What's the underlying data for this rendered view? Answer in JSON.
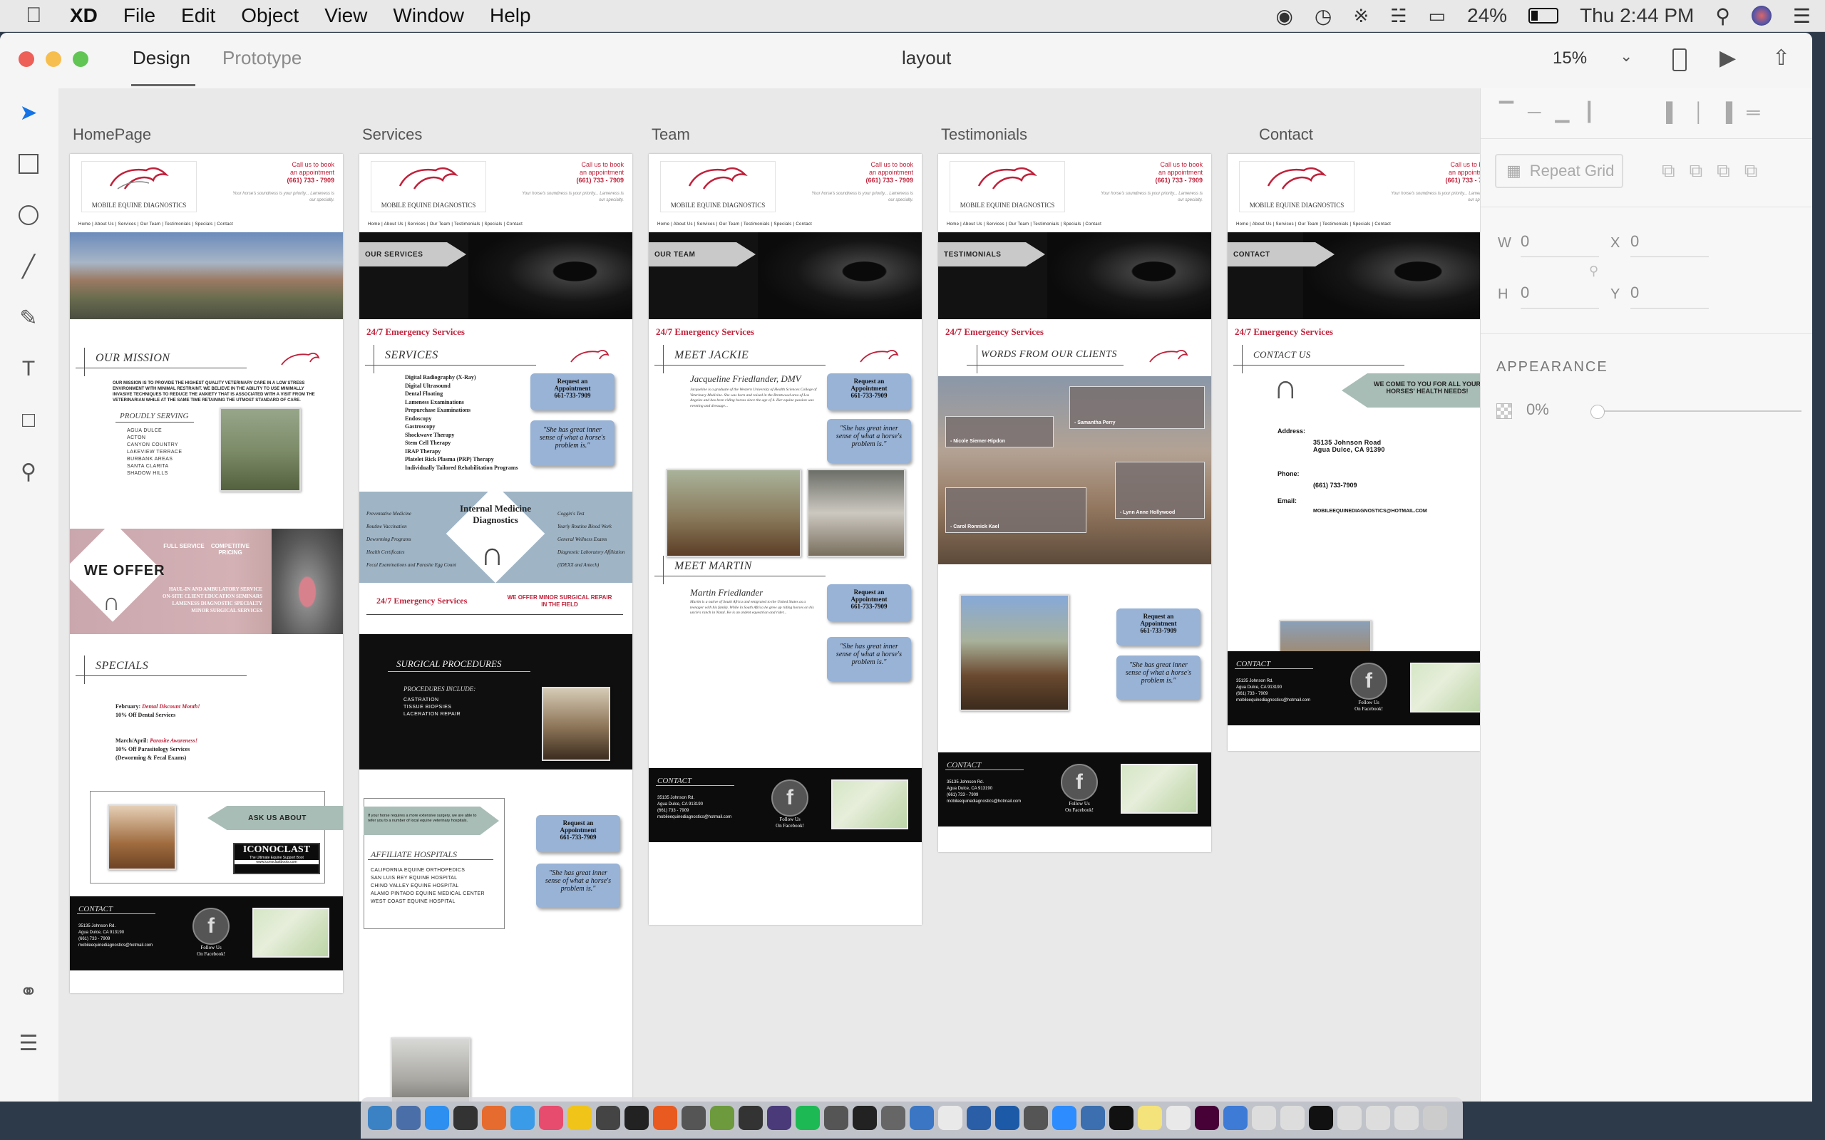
{
  "menubar": {
    "app": "XD",
    "items": [
      "File",
      "Edit",
      "Object",
      "View",
      "Window",
      "Help"
    ],
    "battery": "24%",
    "clock": "Thu 2:44 PM"
  },
  "window": {
    "tabs": {
      "design": "Design",
      "prototype": "Prototype"
    },
    "doc_title": "layout",
    "zoom": "15%"
  },
  "artboards": {
    "home": "HomePage",
    "services": "Services",
    "team": "Team",
    "testimonials": "Testimonials",
    "contact": "Contact"
  },
  "site": {
    "logo_text": "MOBILE EQUINE DIAGNOSTICS",
    "call_text_1": "Call us to book",
    "call_text_2": "an appointment",
    "call_phone": "(661) 733 - 7909",
    "call_sub": "Your horse's soundness is your priority... Lameness is our specialty.",
    "nav": "Home | About Us | Services | Our Team | Testimonials | Specials | Contact",
    "emergency": "24/7 Emergency Services",
    "request_1": "Request an",
    "request_2": "Appointment",
    "request_phone": "661-733-7909",
    "quote": "\"She has great inner sense of what a horse's problem is.\"",
    "contact_title": "CONTACT",
    "contact_info_1": "35135 Johnson Rd.",
    "contact_info_2": "Agua Dulce, CA 913190",
    "contact_info_3": "(661) 733 - 7909",
    "contact_info_4": "mobileequinediagnostics@hotmail.com",
    "follow_1": "Follow Us",
    "follow_2": "On Facebook!",
    "fb_glyph": "f"
  },
  "home": {
    "mission_title": "OUR MISSION",
    "mission_body": "Our mission is to provide the highest quality veterinary care in a low stress environment with minimal restraint. We believe in the ability to use minimally invasive techniques to reduce the anxiety that is associated with a visit from the veterinarian while at the same time retaining the utmost standard of care.",
    "proudly_serving": "PROUDLY SERVING",
    "areas": [
      "Agua Dulce",
      "Acton",
      "Canyon Country",
      "Lakeview Terrace",
      "Burbank Areas",
      "Santa Clarita",
      "Shadow Hills"
    ],
    "we_offer": "WE OFFER",
    "full_service": "FULL SERVICE",
    "competitive_pricing": "COMPETITIVE PRICING",
    "offer_lines": [
      "HAUL-IN AND AMBULATORY SERVICE",
      "ON-SITE CLIENT EDUCATION SEMINARS",
      "LAMENESS DIAGNOSTIC SPECIALTY",
      "MINOR SURGICAL SERVICES"
    ],
    "specials_title": "SPECIALS",
    "feb_label": "February:",
    "feb_italic": "Dental Discount Month!",
    "feb_detail": "10% Off Dental Services",
    "mar_label": "March/April:",
    "mar_italic": "Parasite Awareness!",
    "mar_detail_1": "10% Off Parasitology Services",
    "mar_detail_2": "(Deworming & Fecal Exams)",
    "ask_us": "ASK US ABOUT",
    "iconoclast": "ICONOCLAST",
    "iconoclast_sub": "The Ultimate Equine Support Boot",
    "iconoclast_url": "www.iconoclastboots.com"
  },
  "services": {
    "banner": "OUR SERVICES",
    "section_title": "SERVICES",
    "list": [
      "Digital Radiography (X-Ray)",
      "Digital Ultrasound",
      "Dental Floating",
      "Lameness Examinations",
      "Prepurchase Examinations",
      "Endoscopy",
      "Gastroscopy",
      "Shockwave Therapy",
      "Stem Cell Therapy",
      "IRAP Therapy",
      "Platelet Rick Plasma (PRP) Therapy",
      "Individually Tailored Rehabilitation Programs"
    ],
    "internal_medicine": "Internal Medicine Diagnostics",
    "im_left": [
      "Preventative Medicine",
      "Routine Vaccination",
      "Deworming Programs",
      "Health Certificates",
      "Fecal Examinations and Parasite Egg Count"
    ],
    "im_right": [
      "Coggin's Test",
      "Yearly Routine Blood Work",
      "General Wellness Exams",
      "Diagnostic Laboratory Affiliation (IDEXX and Antech)"
    ],
    "minor_surgical": "We offer minor surgical repair in the field",
    "surgical_title": "SURGICAL PROCEDURES",
    "procedures_include": "PROCEDURES INCLUDE:",
    "procedures": [
      "Castration",
      "Tissue Biopsies",
      "Laceration Repair"
    ],
    "referral_text": "If your horse requires a more extensive surgery, we are able to refer you to a number of local equine veterinary hospitals.",
    "affiliate_title": "AFFILIATE HOSPITALS",
    "hospitals": [
      "California Equine Orthopedics",
      "San Luis Rey Equine Hospital",
      "Chino Valley Equine Hospital",
      "Alamo Pintado Equine Medical Center",
      "West Coast Equine Hospital"
    ]
  },
  "team": {
    "banner": "OUR TEAM",
    "meet_jackie": "MEET JACKIE",
    "jackie_name": "Jacqueline Friedlander, DMV",
    "jackie_bio": "Jacqueline is a graduate of the Western University of Health Sciences College of Veterinary Medicine. She was born and raised in the Brentwood area of Los Angeles and has been riding horses since the age of 4. Her equine passion was eventing and dressage...",
    "meet_martin": "MEET MARTIN",
    "martin_name": "Martin Friedlander",
    "martin_bio": "Martin is a native of South Africa and emigrated to the United States as a teenager with his family. While in South Africa he grew up riding horses on his uncle's ranch in Natal. He is an ardent equestrian and rider..."
  },
  "testimonials": {
    "banner": "TESTIMONIALS",
    "section_title": "WORDS FROM OUR CLIENTS",
    "t1_author": "- Samantha Perry",
    "t2_author": "- Nicole Siemer-Hipdon",
    "t3_author": "- Lynn Anne Hollywood",
    "t4_author": "- Carol Ronnick Kael"
  },
  "contact": {
    "banner": "CONTACT",
    "section_title": "CONTACT US",
    "callout": "WE COME TO YOU FOR ALL YOUR HORSES' HEALTH NEEDS!",
    "address_label": "Address:",
    "address_1": "35135 Johnson Road",
    "address_2": "Agua Dulce, CA 91390",
    "phone_label": "Phone:",
    "phone": "(661) 733-7909",
    "email_label": "Email:",
    "email": "mobileequinediagnostics@hotmail.com"
  },
  "inspector": {
    "repeat_grid": "Repeat Grid",
    "w_label": "W",
    "w_value": "0",
    "h_label": "H",
    "h_value": "0",
    "x_label": "X",
    "x_value": "0",
    "y_label": "Y",
    "y_value": "0",
    "appearance": "APPEARANCE",
    "opacity": "0%"
  }
}
